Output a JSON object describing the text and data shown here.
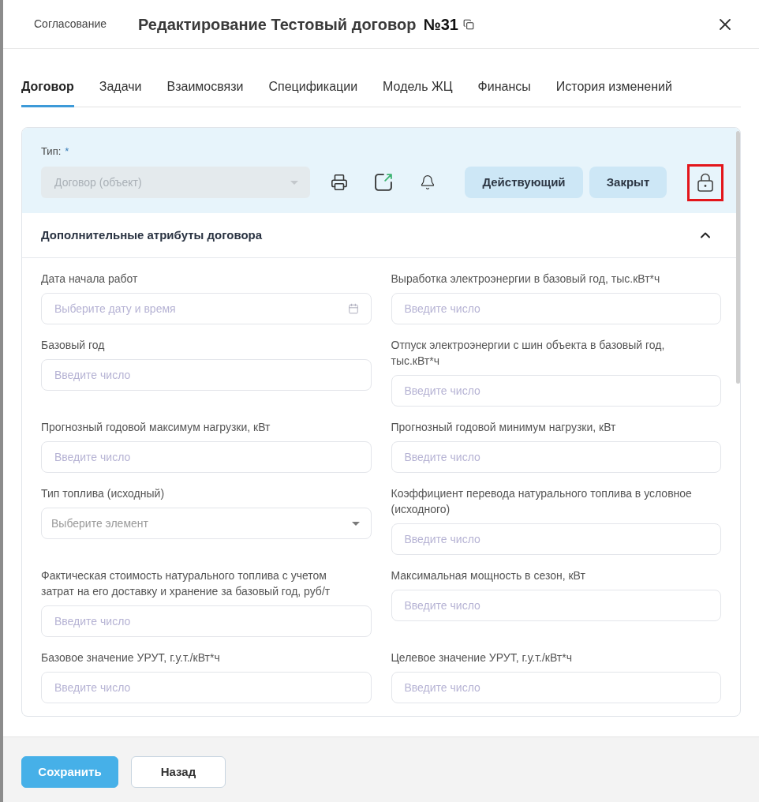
{
  "header": {
    "breadcrumb": "Согласование",
    "title": "Редактирование Тестовый договор",
    "number": "№31"
  },
  "tabs": [
    {
      "label": "Договор",
      "selected": true
    },
    {
      "label": "Задачи",
      "selected": false
    },
    {
      "label": "Взаимосвязи",
      "selected": false
    },
    {
      "label": "Спецификации",
      "selected": false
    },
    {
      "label": "Модель ЖЦ",
      "selected": false
    },
    {
      "label": "Финансы",
      "selected": false
    },
    {
      "label": "История изменений",
      "selected": false
    }
  ],
  "type_field": {
    "label": "Тип:",
    "required_mark": "*",
    "value": "Договор (объект)",
    "disabled": true
  },
  "status_buttons": [
    "Действующий",
    "Закрыт"
  ],
  "lock": {
    "highlighted": true
  },
  "section": {
    "title": "Дополнительные атрибуты договора",
    "expanded": true
  },
  "fields": [
    {
      "label": "Дата начала работ",
      "kind": "date",
      "placeholder": "Выберите дату и время"
    },
    {
      "label": "Выработка электроэнергии в базовый год, тыс.кВт*ч",
      "kind": "number",
      "placeholder": "Введите число"
    },
    {
      "label": "Базовый год",
      "kind": "number",
      "placeholder": "Введите число"
    },
    {
      "label": "Отпуск электроэнергии с шин объекта в базовый год, тыс.кВт*ч",
      "kind": "number",
      "placeholder": "Введите число"
    },
    {
      "label": "Прогнозный годовой максимум нагрузки, кВт",
      "kind": "number",
      "placeholder": "Введите число"
    },
    {
      "label": "Прогнозный годовой минимум нагрузки, кВт",
      "kind": "number",
      "placeholder": "Введите число"
    },
    {
      "label": "Тип топлива (исходный)",
      "kind": "select",
      "placeholder": "Выберите элемент"
    },
    {
      "label": "Коэффициент перевода натурального топлива в условное (исходного)",
      "kind": "number",
      "placeholder": "Введите число"
    },
    {
      "label": "Фактическая стоимость натурального топлива с учетом затрат на его доставку и хранение за базовый год, руб/т",
      "kind": "number",
      "placeholder": "Введите число"
    },
    {
      "label": "Максимальная мощность в сезон, кВт",
      "kind": "number",
      "placeholder": "Введите число"
    },
    {
      "label": "Базовое значение УРУТ, г.у.т./кВт*ч",
      "kind": "number",
      "placeholder": "Введите число"
    },
    {
      "label": "Целевое значение УРУТ, г.у.т./кВт*ч",
      "kind": "number",
      "placeholder": "Введите число"
    }
  ],
  "footer_buttons": [
    {
      "label": "Сохранить",
      "kind": "primary"
    },
    {
      "label": "Назад",
      "kind": "secondary"
    }
  ]
}
